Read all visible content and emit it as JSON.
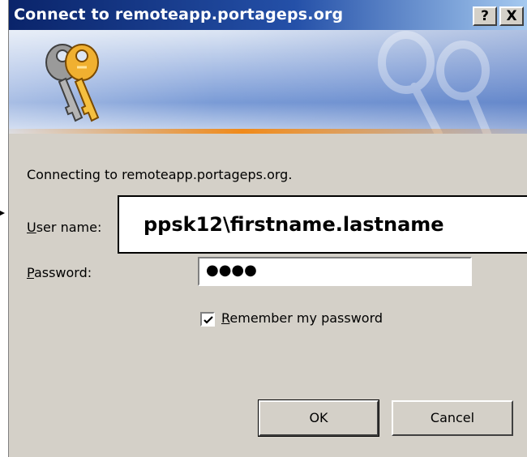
{
  "window": {
    "title": "Connect to remoteapp.portageps.org",
    "help_label": "?",
    "close_label": "X"
  },
  "banner": {
    "icon": "keys-icon",
    "watermark_icon": "keys-watermark-icon"
  },
  "body": {
    "connecting_text": "Connecting to remoteapp.portageps.org.",
    "username_label_accel": "U",
    "username_label_rest": "ser name:",
    "password_label_accel": "P",
    "password_label_rest": "assword:",
    "password_value": "●●●●",
    "remember_accel": "R",
    "remember_rest": "emember my password",
    "remember_checked": true
  },
  "buttons": {
    "ok_label": "OK",
    "cancel_label": "Cancel"
  },
  "callout": {
    "text": "ppsk12\\firstname.lastname"
  },
  "colors": {
    "titlebar_start": "#0a246a",
    "titlebar_end": "#a6caf0",
    "dialog_bg": "#d4d0c8",
    "banner_accent": "#f08a1a"
  }
}
